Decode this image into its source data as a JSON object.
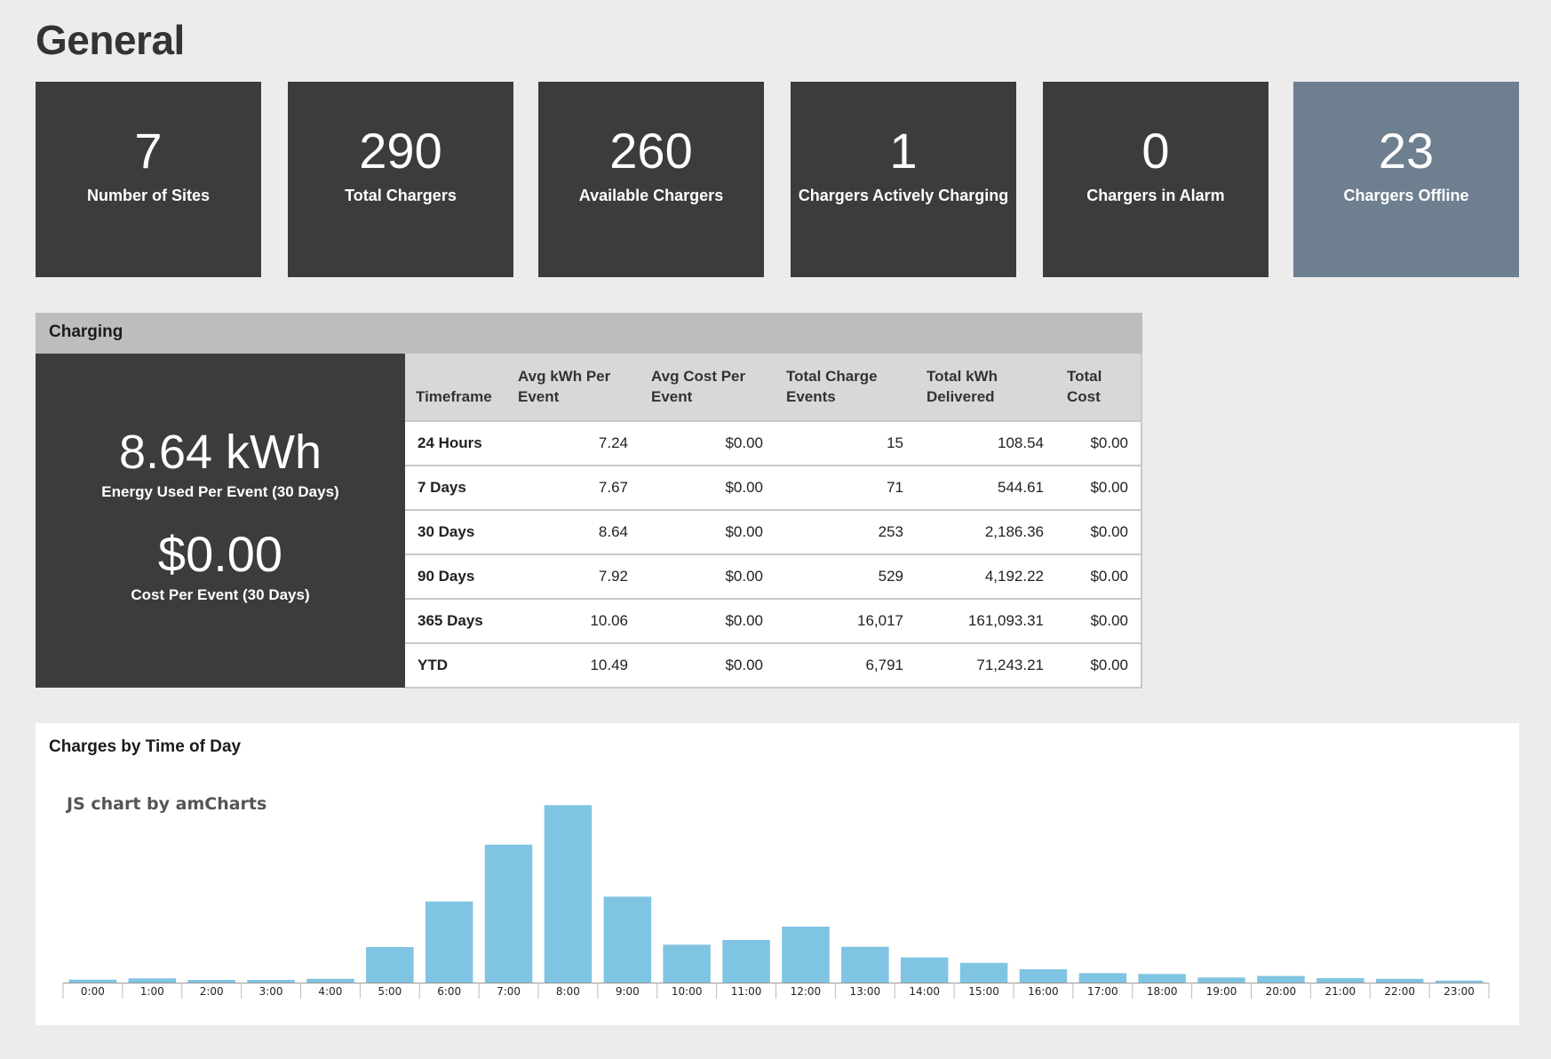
{
  "page": {
    "title": "General"
  },
  "stats": [
    {
      "value": "7",
      "label": "Number of Sites"
    },
    {
      "value": "290",
      "label": "Total Chargers"
    },
    {
      "value": "260",
      "label": "Available Chargers"
    },
    {
      "value": "1",
      "label": "Chargers Actively Charging"
    },
    {
      "value": "0",
      "label": "Chargers in Alarm"
    },
    {
      "value": "23",
      "label": "Chargers Offline"
    }
  ],
  "charging": {
    "title": "Charging",
    "energy_value": "8.64 kWh",
    "energy_label": "Energy Used Per Event (30 Days)",
    "cost_value": "$0.00",
    "cost_label": "Cost Per Event (30 Days)",
    "columns": [
      "Timeframe",
      "Avg kWh Per Event",
      "Avg Cost Per Event",
      "Total Charge Events",
      "Total kWh Delivered",
      "Total Cost"
    ],
    "rows": [
      [
        "24 Hours",
        "7.24",
        "$0.00",
        "15",
        "108.54",
        "$0.00"
      ],
      [
        "7 Days",
        "7.67",
        "$0.00",
        "71",
        "544.61",
        "$0.00"
      ],
      [
        "30 Days",
        "8.64",
        "$0.00",
        "253",
        "2,186.36",
        "$0.00"
      ],
      [
        "90 Days",
        "7.92",
        "$0.00",
        "529",
        "4,192.22",
        "$0.00"
      ],
      [
        "365 Days",
        "10.06",
        "$0.00",
        "16,017",
        "161,093.31",
        "$0.00"
      ],
      [
        "YTD",
        "10.49",
        "$0.00",
        "6,791",
        "71,243.21",
        "$0.00"
      ]
    ]
  },
  "chart_panel": {
    "title": "Charges by Time of Day",
    "credit": "JS chart by amCharts"
  },
  "chart_data": {
    "type": "bar",
    "categories": [
      "0:00",
      "1:00",
      "2:00",
      "3:00",
      "4:00",
      "5:00",
      "6:00",
      "7:00",
      "8:00",
      "9:00",
      "10:00",
      "11:00",
      "12:00",
      "13:00",
      "14:00",
      "15:00",
      "16:00",
      "17:00",
      "18:00",
      "19:00",
      "20:00",
      "21:00",
      "22:00",
      "23:00"
    ],
    "values": [
      20,
      28,
      18,
      18,
      26,
      240,
      548,
      932,
      1198,
      580,
      256,
      288,
      378,
      242,
      170,
      133,
      90,
      64,
      58,
      34,
      45,
      30,
      25,
      14
    ],
    "ylim": [
      0,
      1200
    ],
    "grid": false,
    "color": "#7fc4e2"
  }
}
